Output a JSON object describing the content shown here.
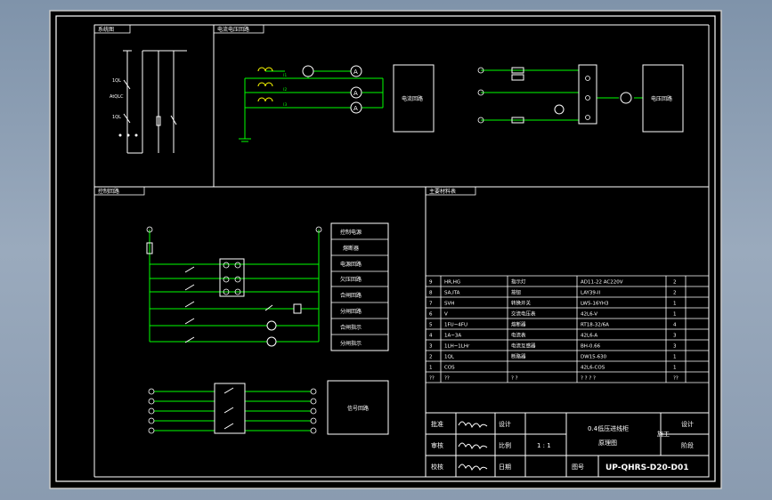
{
  "colors": {
    "background": "#000000",
    "frame": "#ffffff",
    "wire": "#00ff00",
    "terminal": "#ff3b30",
    "label": "#ffffff",
    "mark": "#ffff00"
  },
  "sections": {
    "system": "系统图",
    "measure": "电流电压回路",
    "control": "控制回路",
    "materials": "主要材料表"
  },
  "system_labels": {
    "qs1": "1QL",
    "atdc": "AtQLC",
    "qs2": "1QL"
  },
  "measure": {
    "labels": [
      "I1",
      "I2",
      "I3"
    ],
    "box_left": "电流回路",
    "box_right": "电压回路"
  },
  "control_boxes": [
    "控制电源",
    "熔断器",
    "电源回路",
    "欠压回路",
    "合闸回路",
    "分闸回路",
    "合闸指示",
    "分闸指示"
  ],
  "signal_box": "信号回路",
  "bom": {
    "rows": [
      {
        "no": "9",
        "code": "HR,HG",
        "name": "指示灯",
        "spec": "AD11-22 AC220V",
        "qty": "2"
      },
      {
        "no": "8",
        "code": "SA,ITA",
        "name": "按钮",
        "spec": "LAY39-II",
        "qty": "2"
      },
      {
        "no": "7",
        "code": "SVH",
        "name": "转换开关",
        "spec": "LW5-16YH3",
        "qty": "1"
      },
      {
        "no": "6",
        "code": "V",
        "name": "交流电压表",
        "spec": "42L6-V",
        "qty": "1"
      },
      {
        "no": "5",
        "code": "1FU~4FU",
        "name": "熔断器",
        "spec": "RT18-32/6A",
        "qty": "4"
      },
      {
        "no": "4",
        "code": "1A~3A",
        "name": "电流表",
        "spec": "42L6-A",
        "qty": "3"
      },
      {
        "no": "3",
        "code": "1LH~1LHr",
        "name": "电流互感器",
        "spec": "BH-0.66",
        "qty": "3"
      },
      {
        "no": "2",
        "code": "1QL",
        "name": "断路器",
        "spec": "DW15-630",
        "qty": "1"
      },
      {
        "no": "1",
        "code": "COS",
        "name": "",
        "spec": "42L6-COS",
        "qty": "1"
      },
      {
        "no": "??",
        "code": "??",
        "name": "? ?",
        "spec": "? ? ? ?",
        "qty": "??"
      }
    ]
  },
  "title_block": {
    "r1": [
      "批准",
      "设计"
    ],
    "r2": [
      "审核",
      "比例",
      "1 : 1"
    ],
    "r3": [
      "校核",
      "日期",
      "图号"
    ],
    "project_line1": "0.4低压进线柜",
    "project_line2": "原理图",
    "construction": "施工",
    "design_right": "设计",
    "stage_right": "阶段",
    "drawing_no": "UP-QHRS-D20-D01"
  }
}
